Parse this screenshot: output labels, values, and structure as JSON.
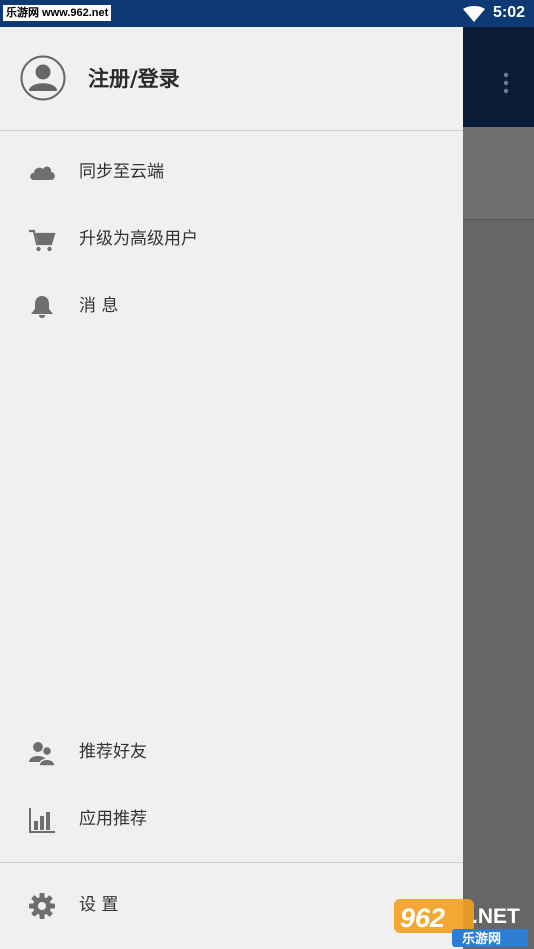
{
  "status_bar": {
    "watermark_text": "乐游网 www.962.net",
    "time": "5:02"
  },
  "drawer": {
    "header": {
      "login_label": "注册/登录"
    },
    "items_top": [
      {
        "label": "同步至云端",
        "icon": "cloud-icon"
      },
      {
        "label": "升级为高级用户",
        "icon": "cart-icon"
      },
      {
        "label": "消 息",
        "icon": "bell-icon"
      }
    ],
    "items_bottom": [
      {
        "label": "推荐好友",
        "icon": "friends-icon"
      },
      {
        "label": "应用推荐",
        "icon": "chart-icon"
      }
    ],
    "settings": {
      "label": "设 置",
      "icon": "gear-icon"
    }
  },
  "watermark": {
    "logo_text": "962.NET",
    "logo_sub": "乐游网"
  },
  "colors": {
    "status_bar": "#0d3a75",
    "drawer_bg": "#f0f0f0",
    "icon": "#6e6e6e",
    "scrim": "#6b6b6b"
  }
}
